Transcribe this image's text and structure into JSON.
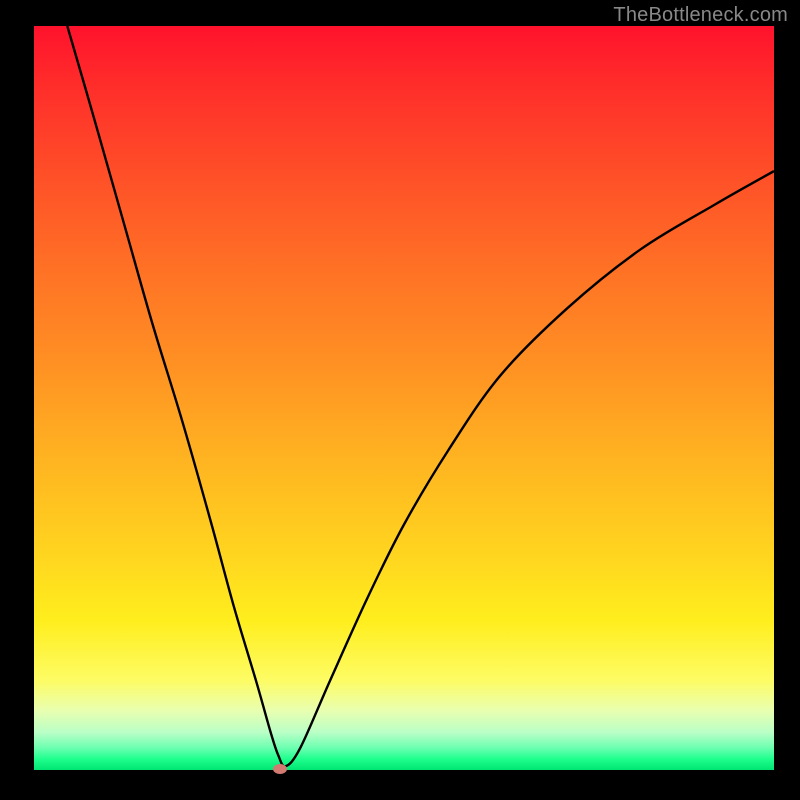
{
  "watermark": "TheBottleneck.com",
  "chart_data": {
    "type": "line",
    "title": "",
    "xlabel": "",
    "ylabel": "",
    "xlim": [
      0,
      100
    ],
    "ylim": [
      0,
      100
    ],
    "legend": false,
    "grid": false,
    "background_gradient": {
      "direction": "vertical",
      "stops": [
        {
          "pos": 0.0,
          "color": "#ff122c"
        },
        {
          "pos": 0.2,
          "color": "#ff4f28"
        },
        {
          "pos": 0.46,
          "color": "#ff9223"
        },
        {
          "pos": 0.7,
          "color": "#ffd21f"
        },
        {
          "pos": 0.88,
          "color": "#fdfc65"
        },
        {
          "pos": 0.95,
          "color": "#b8ffc6"
        },
        {
          "pos": 1.0,
          "color": "#00e572"
        }
      ]
    },
    "series": [
      {
        "name": "bottleneck-curve",
        "color": "#000000",
        "x": [
          4.5,
          8.0,
          12.0,
          16.0,
          20.0,
          24.0,
          27.0,
          30.0,
          32.0,
          33.0,
          34.0,
          36.0,
          40.0,
          45.0,
          50.0,
          56.0,
          63.0,
          72.0,
          82.0,
          92.0,
          100.0
        ],
        "y": [
          100.0,
          88.0,
          74.0,
          60.0,
          47.0,
          33.0,
          22.0,
          12.0,
          5.0,
          2.0,
          0.5,
          3.0,
          12.0,
          23.0,
          33.0,
          43.0,
          53.0,
          62.0,
          70.0,
          76.0,
          80.5
        ]
      }
    ],
    "markers": [
      {
        "name": "min-point",
        "x": 33.3,
        "y": 0.0,
        "color": "#d37a72"
      }
    ]
  }
}
